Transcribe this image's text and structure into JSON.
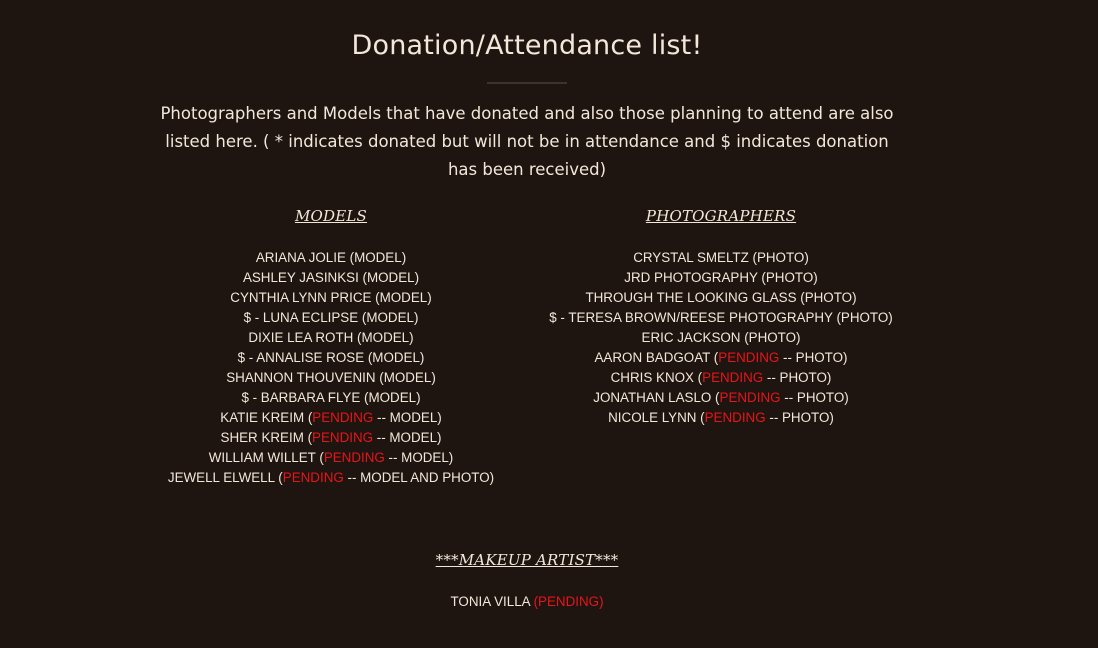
{
  "page": {
    "title": "Donation/Attendance list!",
    "intro": "Photographers and Models that have donated and also those planning to attend are also listed here. ( * indicates donated but will not be in attendance and $ indicates donation has been received)"
  },
  "colors": {
    "background": "#1e1510",
    "text": "#f3e7da",
    "pending": "#e8141b"
  },
  "models": {
    "heading": "MODELS",
    "entries": [
      {
        "text": "ARIANA JOLIE (MODEL)"
      },
      {
        "text": "ASHLEY JASINKSI (MODEL)"
      },
      {
        "text": "CYNTHIA LYNN PRICE (MODEL)"
      },
      {
        "text": "$ - LUNA ECLIPSE (MODEL)"
      },
      {
        "text": "DIXIE LEA ROTH (MODEL)"
      },
      {
        "text": "$ - ANNALISE ROSE (MODEL)"
      },
      {
        "text": "SHANNON THOUVENIN (MODEL)"
      },
      {
        "text": "$ - BARBARA FLYE (MODEL)"
      },
      {
        "before": "KATIE KREIM (",
        "status": "PENDING",
        "after": " -- MODEL)"
      },
      {
        "before": "SHER KREIM (",
        "status": "PENDING",
        "after": " -- MODEL)"
      },
      {
        "before": "WILLIAM WILLET (",
        "status": "PENDING",
        "after": " -- MODEL)"
      },
      {
        "before": "JEWELL ELWELL (",
        "status": "PENDING",
        "after": " -- MODEL AND PHOTO)"
      }
    ]
  },
  "photographers": {
    "heading": "PHOTOGRAPHERS",
    "entries": [
      {
        "text": "CRYSTAL SMELTZ (PHOTO)"
      },
      {
        "text": "JRD PHOTOGRAPHY (PHOTO)"
      },
      {
        "text": "THROUGH THE LOOKING GLASS (PHOTO)"
      },
      {
        "text": "$ - TERESA BROWN/REESE PHOTOGRAPHY (PHOTO)"
      },
      {
        "text": "ERIC JACKSON (PHOTO)"
      },
      {
        "before": "AARON BADGOAT (",
        "status": "PENDING",
        "after": " -- PHOTO)"
      },
      {
        "before": "CHRIS KNOX (",
        "status": "PENDING",
        "after": " -- PHOTO)"
      },
      {
        "before": "JONATHAN LASLO (",
        "status": "PENDING",
        "after": " -- PHOTO)"
      },
      {
        "before": "NICOLE LYNN (",
        "status": "PENDING",
        "after": " -- PHOTO)"
      }
    ]
  },
  "makeup": {
    "heading": "***MAKEUP ARTIST***",
    "entries": [
      {
        "before": "TONIA VILLA ",
        "status": "(PENDING)",
        "after": ""
      }
    ]
  }
}
